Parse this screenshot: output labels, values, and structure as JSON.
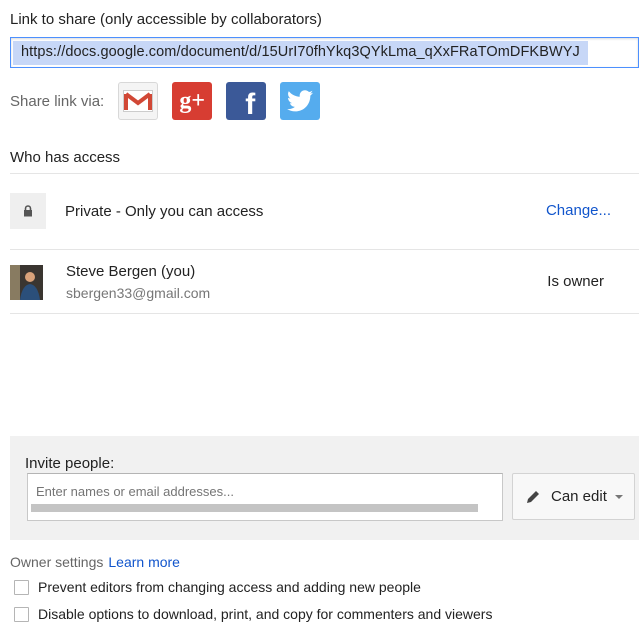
{
  "link_section": {
    "label": "Link to share (only accessible by collaborators)",
    "url": "https://docs.google.com/document/d/15UrI70fhYkq3QYkLma_qXxFRaTOmDFKBWYJ"
  },
  "share_via": {
    "label": "Share link via:",
    "services": [
      {
        "name": "Gmail",
        "icon": "gmail-icon",
        "color": "#d14836"
      },
      {
        "name": "Google+",
        "icon": "google-plus-icon",
        "glyph": "g+",
        "color": "#d73d32"
      },
      {
        "name": "Facebook",
        "icon": "facebook-icon",
        "glyph": "f",
        "color": "#3b5998"
      },
      {
        "name": "Twitter",
        "icon": "twitter-icon",
        "color": "#55acee"
      }
    ]
  },
  "access": {
    "title": "Who has access",
    "visibility": {
      "text": "Private - Only you can access",
      "icon": "lock-icon",
      "change_label": "Change..."
    },
    "people": [
      {
        "name": "Steve Bergen (you)",
        "email": "sbergen33@gmail.com",
        "role": "Is owner"
      }
    ]
  },
  "invite": {
    "label": "Invite people:",
    "placeholder": "Enter names or email addresses...",
    "permission": "Can edit"
  },
  "owner_settings": {
    "label": "Owner settings",
    "learn_more": "Learn more",
    "options": [
      {
        "label": "Prevent editors from changing access and adding new people",
        "checked": false
      },
      {
        "label": "Disable options to download, print, and copy for commenters and viewers",
        "checked": false
      }
    ]
  },
  "colors": {
    "link": "#1155cc",
    "focus_border": "#4d90fe",
    "selection": "#c7d7f7",
    "panel": "#f1f1f1"
  }
}
